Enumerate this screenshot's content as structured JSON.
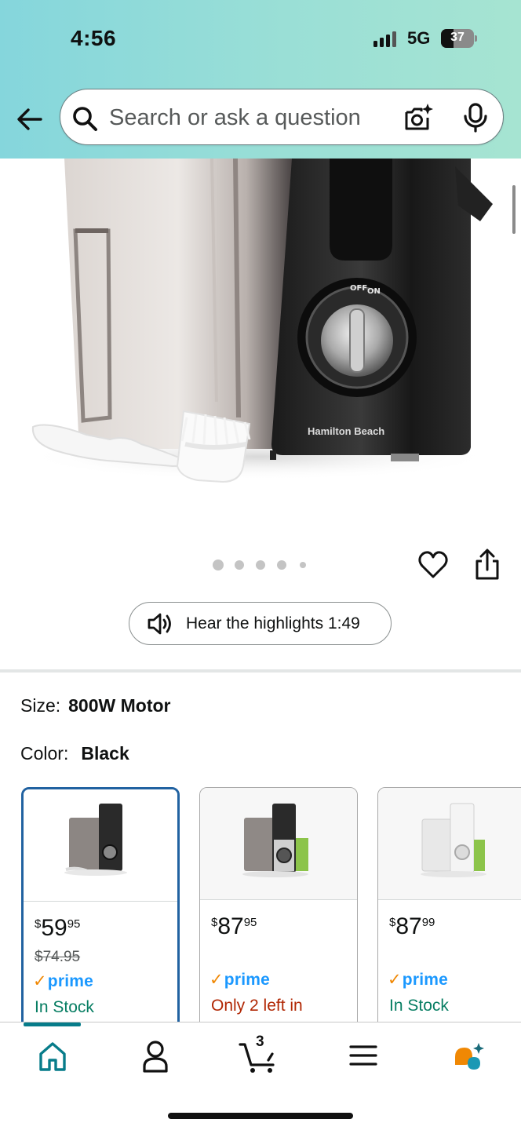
{
  "status_bar": {
    "time": "4:56",
    "network": "5G",
    "battery": "37",
    "battery_fraction": 0.37
  },
  "search": {
    "placeholder": "Search or ask a question"
  },
  "icons": {
    "back": "back-arrow-icon",
    "search": "search-icon",
    "camera": "camera-icon",
    "mic": "microphone-icon",
    "heart": "heart-icon",
    "share": "share-icon",
    "speaker": "speaker-icon",
    "home": "home-icon",
    "account": "user-icon",
    "cart": "cart-icon",
    "menu": "menu-icon",
    "rufus": "rufus-assistant-icon"
  },
  "gallery": {
    "dot_count": 5,
    "active_dot_index": 0,
    "brand_on_product": "Hamilton Beach",
    "switch_labels": [
      "OFF",
      "ON"
    ]
  },
  "audio": {
    "label": "Hear the highlights 1:49"
  },
  "size": {
    "label": "Size:",
    "value": "800W Motor"
  },
  "color": {
    "label": "Color:",
    "value": "Black"
  },
  "swatches": [
    {
      "selected": true,
      "currency": "$",
      "whole": "59",
      "fraction": "95",
      "old_price": "$74.95",
      "prime": "prime",
      "stock": "In Stock",
      "stock_color": "#067d62"
    },
    {
      "selected": false,
      "currency": "$",
      "whole": "87",
      "fraction": "95",
      "old_price": "",
      "prime": "prime",
      "stock": "Only 2 left in",
      "stock_color": "#b12704"
    },
    {
      "selected": false,
      "currency": "$",
      "whole": "87",
      "fraction": "99",
      "old_price": "",
      "prime": "prime",
      "stock": "In Stock",
      "stock_color": "#067d62"
    }
  ],
  "bottom_nav": {
    "cart_count": "3",
    "active": "home"
  },
  "colors": {
    "accent": "#077c8a",
    "header_start": "#85d6dc",
    "header_end": "#a6e4d2",
    "selected_border": "#2162a1",
    "prime_blue": "#1a98ff",
    "prime_check": "#f08804"
  }
}
